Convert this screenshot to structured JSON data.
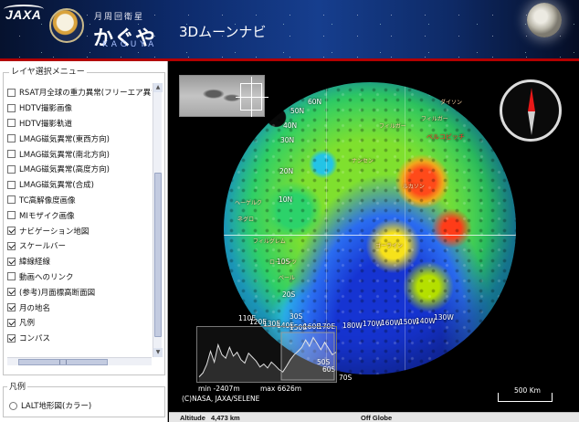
{
  "header": {
    "brand": "JAXA",
    "sub_caption": "月周回衛星",
    "title": "かぐや",
    "romaji": "KAGUYA",
    "app_name": "3Dムーンナビ"
  },
  "layer_menu": {
    "title": "レイヤ選択メニュー",
    "items": [
      {
        "label": "RSAT月全球の重力異常(フリーエア異常",
        "checked": false
      },
      {
        "label": "HDTV撮影画像",
        "checked": false
      },
      {
        "label": "HDTV撮影軌道",
        "checked": false
      },
      {
        "label": "LMAG磁気異常(東西方向)",
        "checked": false
      },
      {
        "label": "LMAG磁気異常(南北方向)",
        "checked": false
      },
      {
        "label": "LMAG磁気異常(高度方向)",
        "checked": false
      },
      {
        "label": "LMAG磁気異常(合成)",
        "checked": false
      },
      {
        "label": "TC高解像度画像",
        "checked": false
      },
      {
        "label": "MIモザイク画像",
        "checked": false
      },
      {
        "label": "ナビゲーション地図",
        "checked": true
      },
      {
        "label": "スケールバー",
        "checked": true
      },
      {
        "label": "緯線経線",
        "checked": true
      },
      {
        "label": "動画へのリンク",
        "checked": false
      },
      {
        "label": "(参考)月面標高断面図",
        "checked": true
      },
      {
        "label": "月の地名",
        "checked": true
      },
      {
        "label": "凡例",
        "checked": true
      },
      {
        "label": "コンパス",
        "checked": true
      }
    ]
  },
  "legend_panel": {
    "title": "凡例",
    "option": "LALT地形図(カラー)"
  },
  "viewer": {
    "lat_labels": [
      "60N",
      "50N",
      "40N",
      "30N",
      "20N",
      "10N",
      "10S",
      "20S",
      "30S",
      "50S",
      "60S",
      "70S"
    ],
    "lon_labels": [
      "110E",
      "120E",
      "130E",
      "140E",
      "150E",
      "160E",
      "170E",
      "180W",
      "170W",
      "160W",
      "150W",
      "140W",
      "130W"
    ],
    "place_names": [
      "ダイソン",
      "フィルガー",
      "フィルガー",
      "ナンセン",
      "ルカソン",
      "ヘーゲルク",
      "ネグロ",
      "ゴーライン",
      "フィルグレム",
      "ローレンツ",
      "ベール"
    ],
    "highlight_place": "ベルコビッチ",
    "profile": {
      "min_label": "min -2407m",
      "max_label": "max 6626m",
      "min_m": -2407,
      "max_m": 6626,
      "elevations": [
        0.1,
        0.18,
        0.35,
        0.62,
        0.4,
        0.75,
        0.55,
        0.48,
        0.7,
        0.52,
        0.6,
        0.45,
        0.38,
        0.58,
        0.5,
        0.42,
        0.3,
        0.36,
        0.28,
        0.4,
        0.33,
        0.25,
        0.2,
        0.32,
        0.45,
        0.55,
        0.62,
        0.7,
        0.85,
        0.72,
        0.9,
        0.78,
        0.65,
        0.8,
        0.68,
        0.55,
        0.6
      ]
    },
    "copyright": "(C)NASA, JAXA/SELENE",
    "scale_label": "500 Km"
  },
  "status": {
    "altitude_label": "Altitude",
    "altitude_value": "4,473 km",
    "globe_status": "Off Globe"
  },
  "colors": {
    "header_bg": "#0d2a6a",
    "header_rule": "#b30000",
    "compass_north": "#e81818",
    "panel_bg": "#ffffff"
  }
}
